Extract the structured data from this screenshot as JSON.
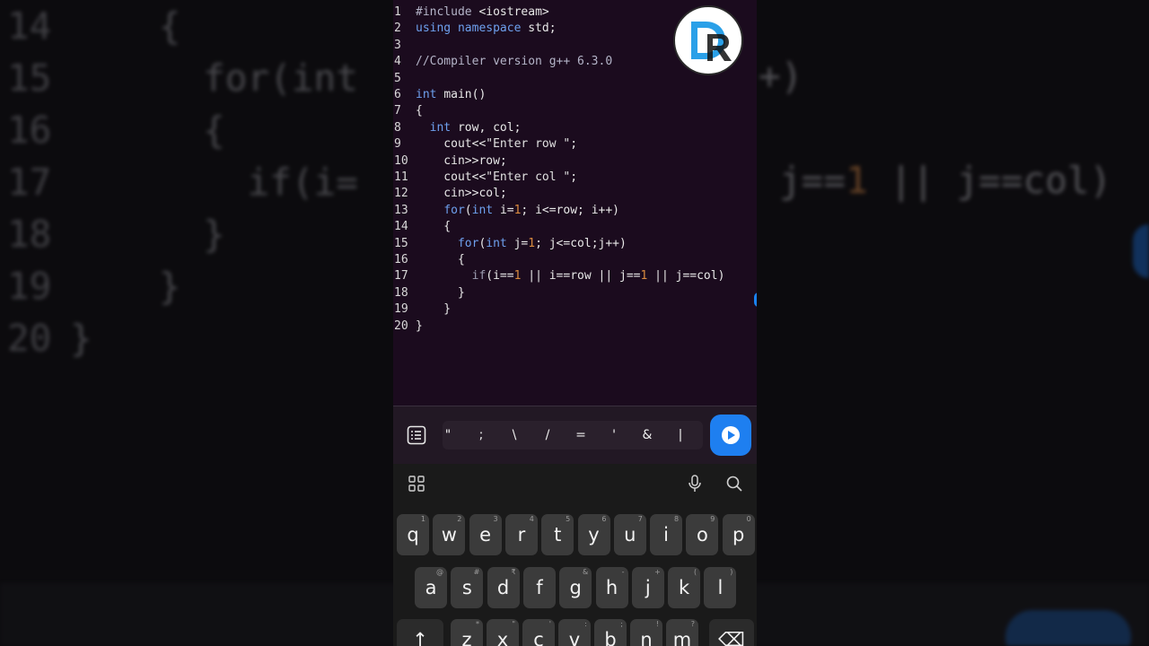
{
  "background": {
    "lines": [
      {
        "num": "14",
        "code": "    {"
      },
      {
        "num": "15",
        "code": "      for(int"
      },
      {
        "num": "16",
        "code": "      {"
      },
      {
        "num": "17",
        "code": "        if(i="
      },
      {
        "num": "18",
        "code": "      }"
      },
      {
        "num": "19",
        "code": "    }"
      },
      {
        "num": "20",
        "code": "}"
      }
    ],
    "right_text_a": "j==",
    "right_text_num": "1",
    "right_text_b": " || j==col)",
    "plus_text": "+)"
  },
  "editor": {
    "lines": [
      {
        "n": "1",
        "parts": [
          [
            "pp",
            "#include "
          ],
          [
            "",
            "<iostream>"
          ]
        ]
      },
      {
        "n": "2",
        "parts": [
          [
            "kw",
            "using namespace "
          ],
          [
            "",
            "std;"
          ]
        ]
      },
      {
        "n": "3",
        "parts": []
      },
      {
        "n": "4",
        "parts": [
          [
            "cm",
            "//Compiler version g++ 6.3.0"
          ]
        ]
      },
      {
        "n": "5",
        "parts": []
      },
      {
        "n": "6",
        "parts": [
          [
            "kw",
            "int "
          ],
          [
            "",
            "main()"
          ]
        ]
      },
      {
        "n": "7",
        "parts": [
          [
            "",
            "{"
          ]
        ]
      },
      {
        "n": "8",
        "parts": [
          [
            "",
            "  "
          ],
          [
            "kw",
            "int "
          ],
          [
            "",
            "row, col;"
          ]
        ]
      },
      {
        "n": "9",
        "parts": [
          [
            "",
            "    cout<<"
          ],
          [
            "str",
            "\"Enter row \""
          ],
          [
            "",
            ";"
          ]
        ]
      },
      {
        "n": "10",
        "parts": [
          [
            "",
            "    cin>>row;"
          ]
        ]
      },
      {
        "n": "11",
        "parts": [
          [
            "",
            "    cout<<"
          ],
          [
            "str",
            "\"Enter col \""
          ],
          [
            "",
            ";"
          ]
        ]
      },
      {
        "n": "12",
        "parts": [
          [
            "",
            "    cin>>col;"
          ]
        ]
      },
      {
        "n": "13",
        "parts": [
          [
            "",
            "    "
          ],
          [
            "kw",
            "for"
          ],
          [
            "",
            "("
          ],
          [
            "kw",
            "int "
          ],
          [
            "",
            "i="
          ],
          [
            "num",
            "1"
          ],
          [
            "",
            "; i<=row; i++)"
          ]
        ]
      },
      {
        "n": "14",
        "parts": [
          [
            "",
            "    {"
          ]
        ]
      },
      {
        "n": "15",
        "parts": [
          [
            "",
            "      "
          ],
          [
            "kw",
            "for"
          ],
          [
            "",
            "("
          ],
          [
            "kw",
            "int "
          ],
          [
            "",
            "j="
          ],
          [
            "num",
            "1"
          ],
          [
            "",
            "; j<=col;j++)"
          ]
        ]
      },
      {
        "n": "16",
        "parts": [
          [
            "",
            "      {"
          ]
        ]
      },
      {
        "n": "17",
        "parts": [
          [
            "",
            "        "
          ],
          [
            "if",
            "if"
          ],
          [
            "",
            "(i=="
          ],
          [
            "num",
            "1"
          ],
          [
            "",
            " || i==row || j=="
          ],
          [
            "num",
            "1"
          ],
          [
            "",
            " || j==col)"
          ]
        ]
      },
      {
        "n": "18",
        "parts": [
          [
            "",
            "      }"
          ]
        ]
      },
      {
        "n": "19",
        "parts": [
          [
            "",
            "    }"
          ]
        ]
      },
      {
        "n": "20",
        "parts": [
          [
            "",
            "}"
          ]
        ]
      }
    ]
  },
  "logo": {
    "text": "DR"
  },
  "symbol_bar": {
    "symbols": [
      "\"",
      ";",
      "\\",
      "/",
      "=",
      "'",
      "&",
      "|"
    ],
    "menu_icon": "list-icon",
    "run_icon": "play-icon"
  },
  "keyboard": {
    "toolbar_icons": [
      "grid-icon",
      "mic-icon",
      "search-icon"
    ],
    "row1": [
      {
        "k": "q",
        "s": "1"
      },
      {
        "k": "w",
        "s": "2"
      },
      {
        "k": "e",
        "s": "3"
      },
      {
        "k": "r",
        "s": "4"
      },
      {
        "k": "t",
        "s": "5"
      },
      {
        "k": "y",
        "s": "6"
      },
      {
        "k": "u",
        "s": "7"
      },
      {
        "k": "i",
        "s": "8"
      },
      {
        "k": "o",
        "s": "9"
      },
      {
        "k": "p",
        "s": "0"
      }
    ],
    "row2": [
      {
        "k": "a",
        "s": "@"
      },
      {
        "k": "s",
        "s": "#"
      },
      {
        "k": "d",
        "s": "₹"
      },
      {
        "k": "f",
        "s": ""
      },
      {
        "k": "g",
        "s": "&"
      },
      {
        "k": "h",
        "s": "-"
      },
      {
        "k": "j",
        "s": "+"
      },
      {
        "k": "k",
        "s": "("
      },
      {
        "k": "l",
        "s": ")"
      }
    ],
    "row3": [
      {
        "k": "↑",
        "s": ""
      },
      {
        "k": "z",
        "s": "*"
      },
      {
        "k": "x",
        "s": "\""
      },
      {
        "k": "c",
        "s": "'"
      },
      {
        "k": "v",
        "s": ":"
      },
      {
        "k": "b",
        "s": ";"
      },
      {
        "k": "n",
        "s": "!"
      },
      {
        "k": "m",
        "s": "?"
      },
      {
        "k": "⌫",
        "s": ""
      }
    ]
  },
  "colors": {
    "accent": "#1e7ff0",
    "editor_bg": "#1b0b1e",
    "keyword": "#6ea0ee",
    "number": "#d98a3f"
  }
}
